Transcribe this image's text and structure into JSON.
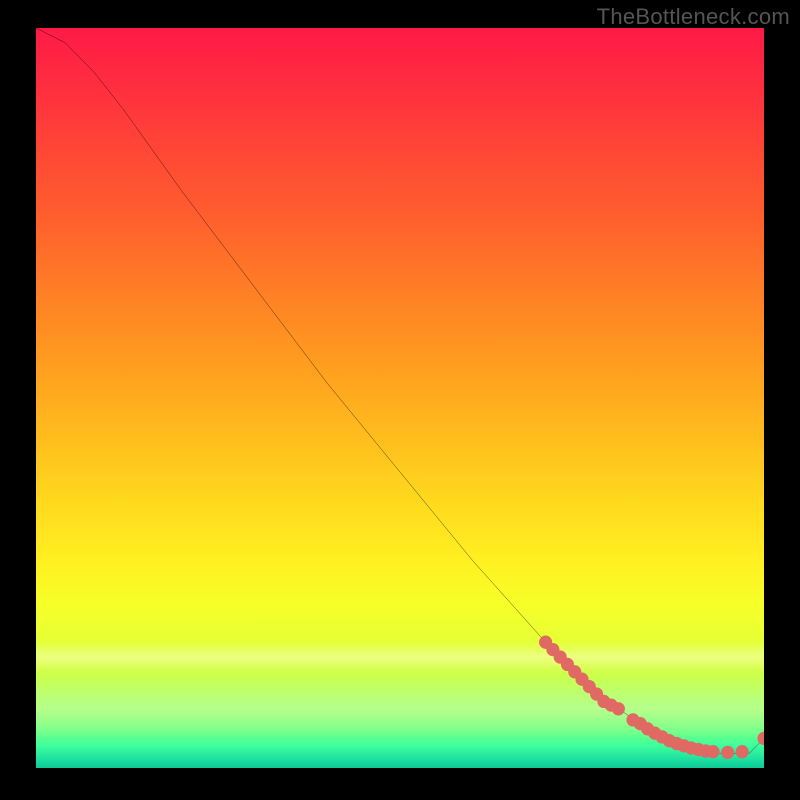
{
  "watermark": "TheBottleneck.com",
  "chart_data": {
    "type": "line",
    "title": "",
    "xlabel": "",
    "ylabel": "",
    "xlim": [
      0,
      100
    ],
    "ylim": [
      0,
      100
    ],
    "grid": false,
    "legend": false,
    "series": [
      {
        "name": "bottleneck-curve",
        "color": "#000000",
        "x": [
          0,
          4,
          8,
          12,
          20,
          30,
          40,
          50,
          60,
          70,
          76,
          80,
          83,
          86,
          89,
          92,
          95,
          98,
          100
        ],
        "y": [
          100,
          98,
          94,
          89,
          78,
          65,
          52,
          40,
          28,
          17,
          11,
          8,
          6,
          4,
          3,
          2,
          2,
          2,
          4
        ]
      }
    ],
    "markers": [
      {
        "name": "cluster-a",
        "color": "#e06a63",
        "points_xy": [
          [
            70,
            17
          ],
          [
            71,
            16
          ],
          [
            72,
            15
          ],
          [
            73,
            14
          ],
          [
            74,
            13
          ],
          [
            75,
            12
          ],
          [
            76,
            11
          ],
          [
            77,
            10
          ],
          [
            78,
            9
          ],
          [
            79,
            8.5
          ],
          [
            80,
            8
          ]
        ]
      },
      {
        "name": "cluster-b",
        "color": "#e06a63",
        "points_xy": [
          [
            82,
            6.5
          ],
          [
            83,
            6
          ],
          [
            84,
            5.3
          ],
          [
            85,
            4.7
          ],
          [
            86,
            4.2
          ],
          [
            87,
            3.7
          ],
          [
            88,
            3.3
          ],
          [
            89,
            3
          ],
          [
            90,
            2.7
          ],
          [
            91,
            2.5
          ],
          [
            92,
            2.3
          ],
          [
            93,
            2.2
          ],
          [
            95,
            2.1
          ],
          [
            97,
            2.2
          ],
          [
            100,
            4
          ]
        ]
      }
    ]
  }
}
